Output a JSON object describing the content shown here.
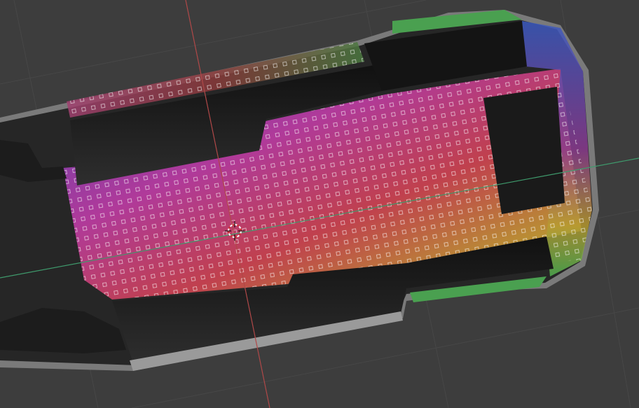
{
  "viewport": {
    "background": "#3d3d3d",
    "grid_color": "#4a4a4a",
    "x_axis_color": "#b04848",
    "y_axis_color": "#3f9a6c"
  },
  "mesh": {
    "texture": "uv-color-grid",
    "colors": [
      "#7a3fb0",
      "#c03a9a",
      "#c0404a",
      "#b8a030",
      "#3a6ac0",
      "#40a860",
      "#40b8c0"
    ]
  },
  "cursor": {
    "icon": "3d-cursor-icon"
  }
}
